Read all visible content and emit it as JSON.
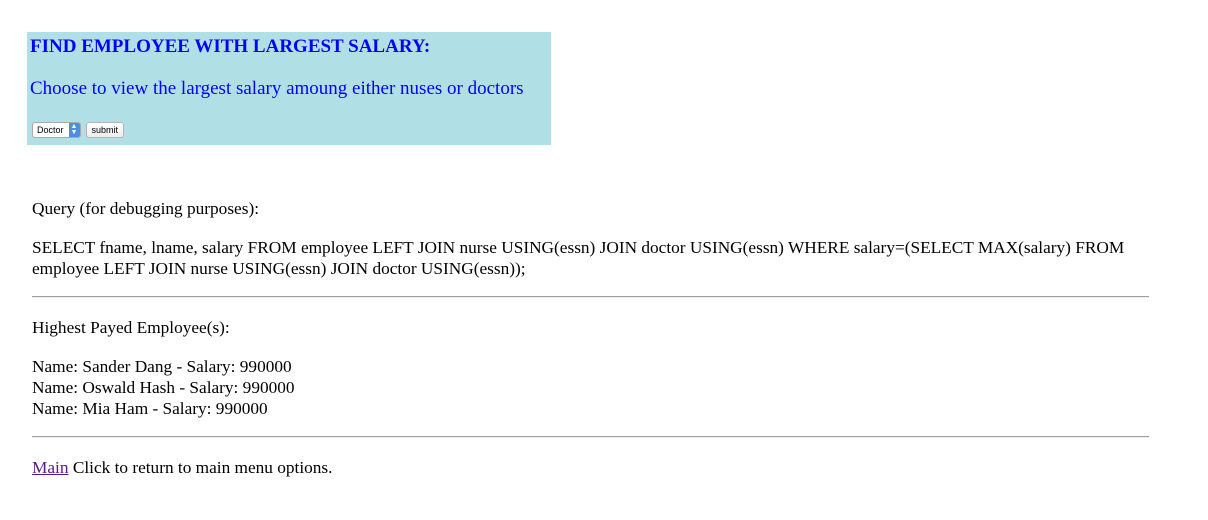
{
  "form": {
    "title": "FIND EMPLOYEE WITH LARGEST SALARY:",
    "description": "Choose to view the largest salary amoung either nuses or doctors",
    "select_value": "Doctor",
    "submit_label": "submit",
    "panel_color": "#b0e0e6",
    "text_color": "#0000ff"
  },
  "query": {
    "label": "Query (for debugging purposes):",
    "sql": "SELECT fname, lname, salary FROM employee LEFT JOIN nurse USING(essn) JOIN doctor USING(essn) WHERE salary=(SELECT MAX(salary) FROM employee LEFT JOIN nurse USING(essn) JOIN doctor USING(essn));"
  },
  "results": {
    "label": "Highest Payed Employee(s):",
    "rows": [
      "Name: Sander Dang - Salary: 990000",
      "Name: Oswald Hash - Salary: 990000",
      "Name: Mia Ham - Salary: 990000"
    ]
  },
  "footer": {
    "link_text": "Main",
    "text": "Click to return to main menu options."
  }
}
